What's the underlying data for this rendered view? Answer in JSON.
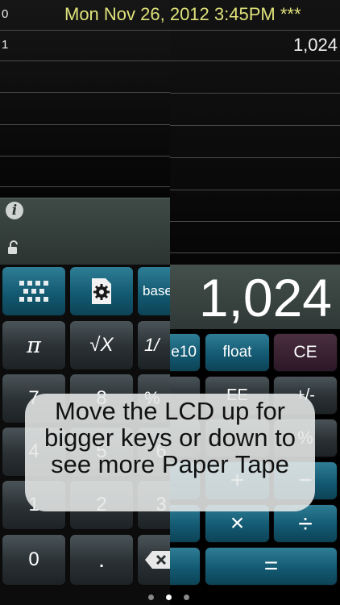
{
  "status": {
    "datetime": "Mon Nov 26, 2012 3:45PM ***"
  },
  "tape": {
    "row_labels": [
      "0",
      "1"
    ],
    "row_value": "1,024"
  },
  "display": {
    "value": "1,024"
  },
  "left_keys": {
    "base_label": "base",
    "pi": "π",
    "sqrt": "√X",
    "inv": "1/",
    "r3": [
      "7",
      "8",
      "%"
    ],
    "r4": [
      "4",
      "5",
      "6"
    ],
    "r5": [
      "1",
      "2",
      "3"
    ],
    "zero": "0",
    "dot": "."
  },
  "right_keys": {
    "e10": "e10",
    "float": "float",
    "ce": "CE",
    "ee": "EE",
    "plusminus": "+/-",
    "percent": "%",
    "plus": "+",
    "minus": "−",
    "times": "×",
    "divide": "÷",
    "equals": "="
  },
  "hint": "Move the LCD up for bigger keys or down to see more Paper Tape",
  "colors": {
    "date_yellow": "#dfe27a",
    "teal_key": "#135a72",
    "purple_key": "#2c1726"
  },
  "icons": [
    "info-icon",
    "lock-icon",
    "grid-icon",
    "gear-document-icon",
    "backspace-icon"
  ]
}
